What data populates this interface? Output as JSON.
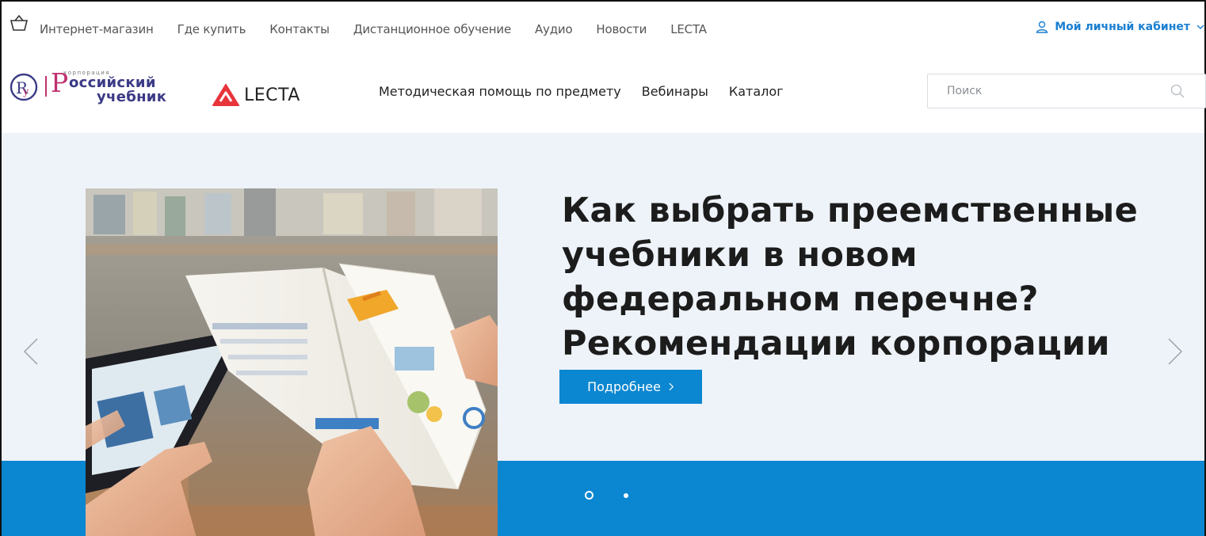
{
  "topbar": {
    "links": [
      "Интернет-магазин",
      "Где купить",
      "Контакты",
      "Дистанционное обучение",
      "Аудио",
      "Новости",
      "LECTA"
    ],
    "account_label": "Мой личный кабинет"
  },
  "logos": {
    "corp_small": "корпорация",
    "corp_letter": "Р",
    "corp_line1": "оссийский",
    "corp_line2": "учебник",
    "lecta": "LECTA"
  },
  "mainnav": {
    "items": [
      "Методическая помощь по предмету",
      "Вебинары",
      "Каталог"
    ]
  },
  "search": {
    "placeholder": "Поиск"
  },
  "hero": {
    "title_lines": [
      "Как выбрать преемственные",
      "учебники в новом",
      "федеральном перечне?",
      "Рекомендации корпорации"
    ],
    "button_label": "Подробнее",
    "slides_total": 2,
    "active_slide": 1
  },
  "colors": {
    "accent": "#0b86d0",
    "brand_magenta": "#c0316e",
    "brand_navy": "#3b3a86",
    "lecta_red": "#e8343b",
    "hero_bg": "#eef3f9"
  }
}
